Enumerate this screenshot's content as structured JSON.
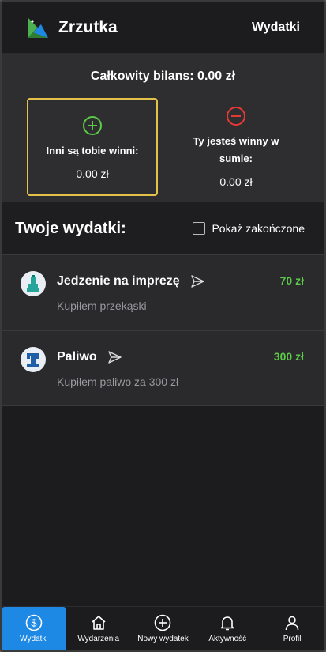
{
  "header": {
    "app_name": "Zrzutka",
    "nav_link": "Wydatki"
  },
  "balance": {
    "total": "Całkowity bilans: 0.00 zł",
    "owed_to_you": {
      "label": "Inni są tobie winni:",
      "amount": "0.00 zł"
    },
    "you_owe": {
      "label_line1": "Ty jesteś winny w",
      "label_line2": "sumie:",
      "amount": "0.00 zł"
    }
  },
  "expenses": {
    "title": "Twoje wydatki:",
    "show_finished_label": "Pokaż zakończone",
    "items": [
      {
        "name": "Jedzenie na imprezę",
        "description": "Kupiłem przekąski",
        "amount": "70 zł"
      },
      {
        "name": "Paliwo",
        "description": "Kupiłem paliwo za 300 zł",
        "amount": "300 zł"
      }
    ]
  },
  "nav": [
    {
      "label": "Wydatki",
      "icon": "dollar-icon",
      "active": true
    },
    {
      "label": "Wydarzenia",
      "icon": "home-icon"
    },
    {
      "label": "Nowy wydatek",
      "icon": "plus-circle-icon"
    },
    {
      "label": "Aktywność",
      "icon": "bell-icon"
    },
    {
      "label": "Profil",
      "icon": "user-icon"
    }
  ],
  "colors": {
    "accent": "#1e88e5",
    "positive": "#5cc947",
    "negative": "#e53935",
    "highlight_border": "#e3c24a"
  }
}
